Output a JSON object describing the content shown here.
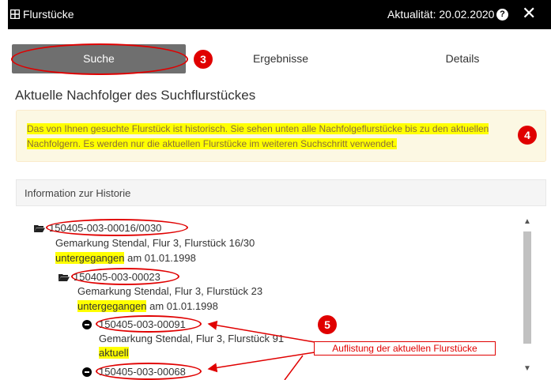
{
  "window": {
    "title": "Flurstücke",
    "actuality": "Aktualität: 20.02.2020",
    "help_glyph": "?",
    "close_glyph": "✕"
  },
  "tabs": [
    {
      "label": "Suche",
      "active": true
    },
    {
      "label": "Ergebnisse",
      "active": false
    },
    {
      "label": "Details",
      "active": false
    }
  ],
  "heading": "Aktuelle Nachfolger des Suchflurstückes",
  "alert": {
    "text": "Das von Ihnen gesuchte Flurstück ist historisch. Sie sehen unten alle Nachfolgeflurstücke bis zu den aktuellen Nachfolgern. Es werden nur die aktuellen Flurstücke im weiteren Suchschritt verwendet."
  },
  "panel": {
    "title": "Information zur Historie"
  },
  "tree": [
    {
      "id": "150405-003-00016/0030",
      "desc": "Gemarkung Stendal, Flur 3, Flurstück 16/30",
      "status": "untergegangen",
      "status_suffix": "am 01.01.1998",
      "icon": "folder-open-icon"
    },
    {
      "id": "150405-003-00023",
      "desc": "Gemarkung Stendal, Flur 3, Flurstück 23",
      "status": "untergegangen",
      "status_suffix": "am 01.01.1998",
      "icon": "folder-open-icon"
    },
    {
      "id": "150405-003-00091",
      "desc": "Gemarkung Stendal, Flur 3, Flurstück 91",
      "status": "aktuell",
      "status_suffix": "",
      "icon": "minus-circle-icon"
    },
    {
      "id": "150405-003-00068",
      "desc": "",
      "status": "",
      "status_suffix": "",
      "icon": "minus-circle-icon"
    }
  ],
  "annotations": {
    "badge_3": "3",
    "badge_4": "4",
    "badge_5": "5",
    "callout": "Auflistung der aktuellen Flurstücke",
    "color": "#e00000"
  },
  "colors": {
    "titlebar": "#000000",
    "active_tab": "#6f6f6f",
    "alert_bg": "#fcf8e3",
    "alert_text": "#8a6d3b",
    "highlight": "#ffff00"
  }
}
